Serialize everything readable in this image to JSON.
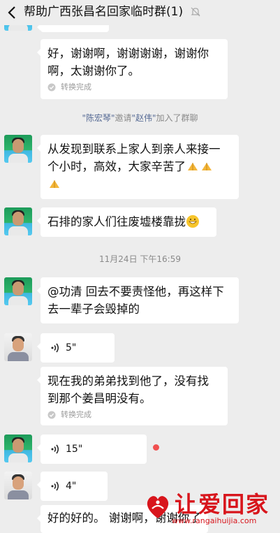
{
  "header": {
    "title": "帮助广西张昌名回家临时群(1)",
    "back_icon": "chevron-left-icon",
    "mute_icon": "bell-off-icon"
  },
  "messages": {
    "m1": {
      "text_line1": "好，谢谢啊，谢谢谢谢，谢谢你",
      "text_line2": "啊，太谢谢你了。",
      "convert_status": "转换完成"
    },
    "system": {
      "inviter": "\"陈宏琴\"",
      "verb": "邀请",
      "invitee": "\"赵伟\"",
      "suffix": "加入了群聊"
    },
    "m2": {
      "text_line1": "从发现到联系上家人到亲人来接一",
      "text_line2": "个小时，高效，大家辛苦了"
    },
    "m3": {
      "text": "石排的家人们往废墟楼靠拢"
    },
    "timestamp": "11月24日 下午16:59",
    "m4": {
      "text_line1": "@功清  回去不要责怪他，再这样下",
      "text_line2": "去一辈子会毁掉的"
    },
    "m5": {
      "duration": "5\""
    },
    "m6": {
      "text_line1": "现在我的弟弟找到他了，没有找",
      "text_line2": "到那个姜昌明没有。",
      "convert_status": "转换完成"
    },
    "m7": {
      "duration": "15\""
    },
    "m8": {
      "duration": "4\""
    },
    "m9": {
      "text": "好的好的。  谢谢啊，谢谢你了"
    }
  },
  "watermark": {
    "brand": "让爱回家",
    "url": "www.rangaihuijia.com",
    "color": "#d8151c"
  },
  "colors": {
    "background": "#ededed",
    "bubble": "#ffffff",
    "link_name": "#576b95",
    "unread_dot": "#f05050"
  }
}
